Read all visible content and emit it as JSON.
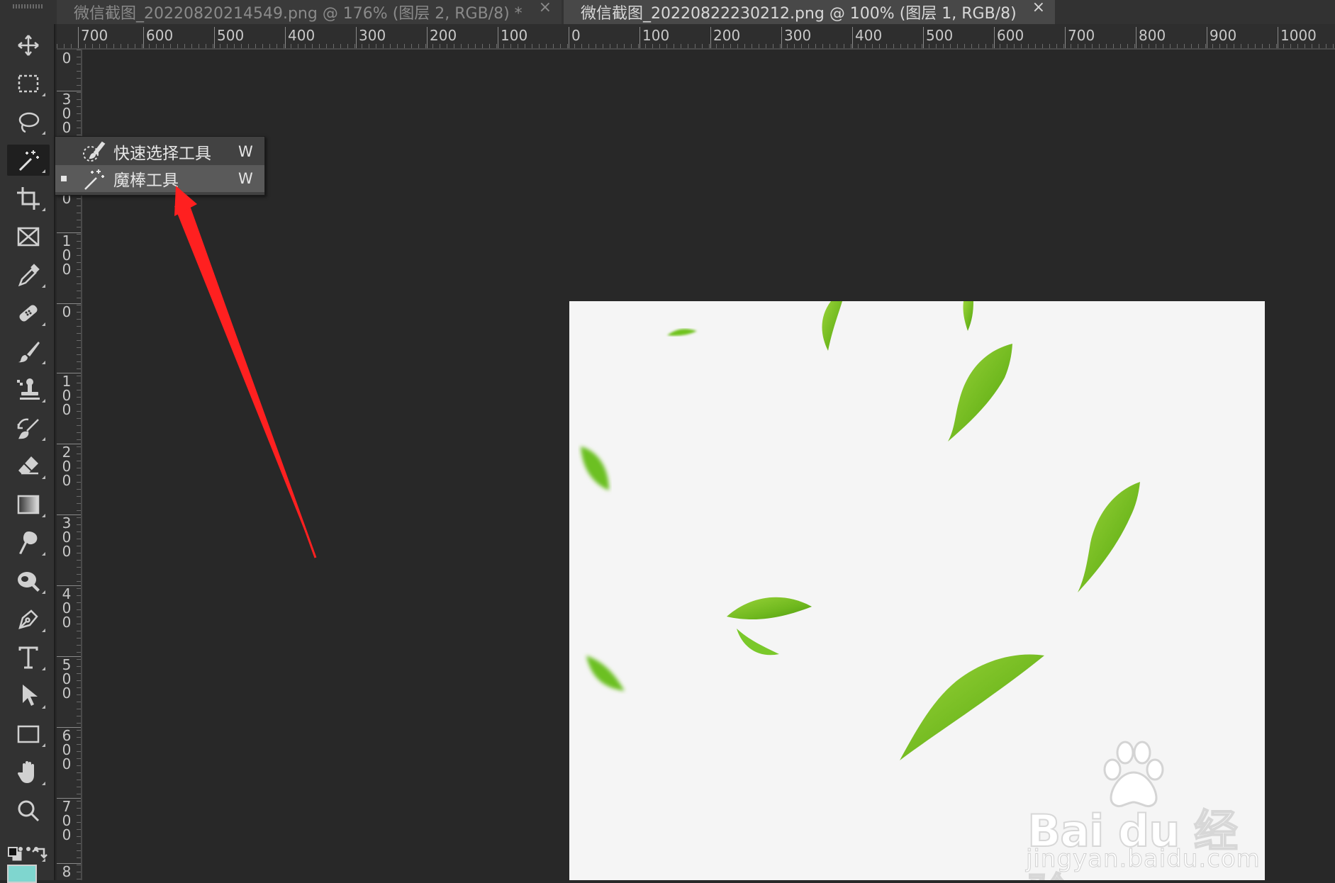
{
  "tabs": [
    {
      "title": "微信截图_20220820214549.png @ 176% (图层 2, RGB/8) *",
      "close": "×",
      "active": false
    },
    {
      "title": "微信截图_20220822230212.png @ 100% (图层 1, RGB/8)",
      "close": "×",
      "active": true
    }
  ],
  "toolbar": {
    "tools": [
      {
        "name": "move-tool",
        "icon": "move-icon"
      },
      {
        "name": "rectangular-marquee-tool",
        "icon": "marquee-icon"
      },
      {
        "name": "lasso-tool",
        "icon": "lasso-icon"
      },
      {
        "name": "magic-wand-tool",
        "icon": "magic-wand-icon",
        "active": true
      },
      {
        "name": "crop-tool",
        "icon": "crop-icon"
      },
      {
        "name": "frame-tool",
        "icon": "frame-icon"
      },
      {
        "name": "eyedropper-tool",
        "icon": "eyedropper-icon"
      },
      {
        "name": "healing-brush-tool",
        "icon": "bandage-icon"
      },
      {
        "name": "brush-tool",
        "icon": "brush-icon"
      },
      {
        "name": "clone-stamp-tool",
        "icon": "stamp-icon"
      },
      {
        "name": "history-brush-tool",
        "icon": "history-brush-icon"
      },
      {
        "name": "eraser-tool",
        "icon": "eraser-icon"
      },
      {
        "name": "gradient-tool",
        "icon": "gradient-icon"
      },
      {
        "name": "blur-tool",
        "icon": "blur-icon"
      },
      {
        "name": "dodge-tool",
        "icon": "dodge-icon"
      },
      {
        "name": "pen-tool",
        "icon": "pen-icon"
      },
      {
        "name": "type-tool",
        "icon": "type-icon"
      },
      {
        "name": "path-selection-tool",
        "icon": "arrow-cursor-icon"
      },
      {
        "name": "rectangle-tool",
        "icon": "rectangle-icon"
      },
      {
        "name": "hand-tool",
        "icon": "hand-icon"
      },
      {
        "name": "zoom-tool",
        "icon": "zoom-icon"
      },
      {
        "name": "edit-toolbar",
        "icon": "more-icon"
      }
    ],
    "foreground_color": "#1a1a1a",
    "background_color": "#7fd6cf"
  },
  "flyout": {
    "items": [
      {
        "label": "快速选择工具",
        "shortcut": "W",
        "icon": "quick-selection-icon",
        "selected": false
      },
      {
        "label": "魔棒工具",
        "shortcut": "W",
        "icon": "magic-wand-icon",
        "selected": true
      }
    ]
  },
  "rulers": {
    "horizontal": [
      "700",
      "600",
      "500",
      "400",
      "300",
      "200",
      "100",
      "0",
      "100",
      "200",
      "300",
      "400",
      "500",
      "600",
      "700",
      "800",
      "900",
      "1000"
    ],
    "vertical": [
      "0",
      "3\n0\n0",
      "2\n0\n0",
      "1\n0\n0",
      "0",
      "1\n0\n0",
      "2\n0\n0",
      "3\n0\n0",
      "4\n0\n0",
      "5\n0\n0",
      "6\n0\n0",
      "7\n0\n0",
      "8"
    ]
  },
  "canvas": {
    "background": "#f5f5f5",
    "subject": "falling green leaves",
    "watermark": {
      "main": "Bai du 经验",
      "sub": "jingyan.baidu.com"
    }
  },
  "annotation": {
    "arrow_color": "#ff2222"
  }
}
